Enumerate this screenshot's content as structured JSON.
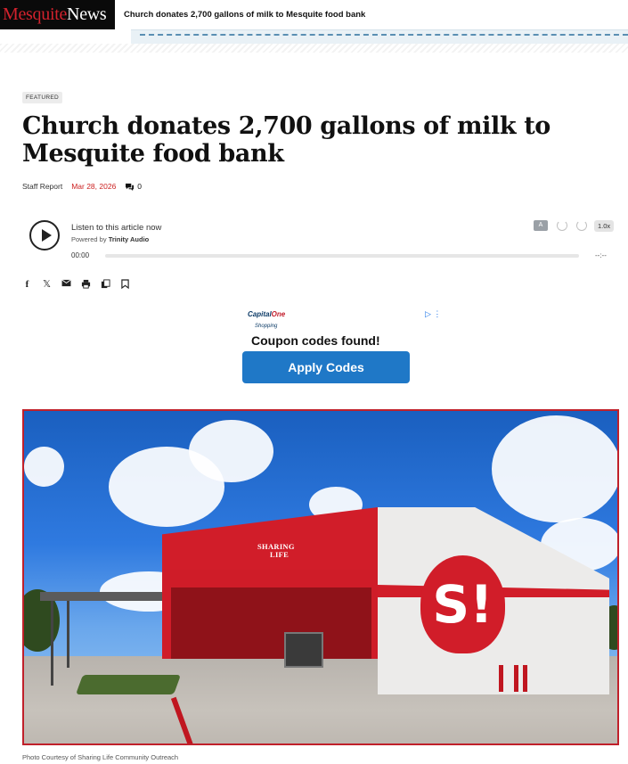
{
  "header": {
    "logo_part1": "Mesquite",
    "logo_part2": "News",
    "headline": "Church donates 2,700 gallons of milk to Mesquite food bank"
  },
  "article": {
    "category": "FEATURED",
    "title": "Church donates 2,700 gallons of milk to Mesquite food bank",
    "author": "Staff Report",
    "date": "Mar 28, 2026",
    "comment_count": "0",
    "caption": "Photo Courtesy of Sharing Life Community Outreach"
  },
  "audio": {
    "listen_label": "Listen to this article now",
    "powered_prefix": "Powered by",
    "powered_brand": "Trinity Audio",
    "time_current": "00:00",
    "time_total": "--:--",
    "speed": "1.0x",
    "progress": 0
  },
  "share": {
    "icons": [
      "facebook-icon",
      "x-icon",
      "email-icon",
      "print-icon",
      "copy-icon",
      "bookmark-icon"
    ]
  },
  "ad": {
    "brand": "Capital",
    "brand_one": "One",
    "brand_sub": "Shopping",
    "headline": "Coupon codes found!",
    "button_label": "Apply Codes"
  },
  "hero": {
    "sign_line1": "SHARING",
    "sign_line2": "LIFE"
  },
  "colors": {
    "brand_red": "#d2222d",
    "ad_button": "#1f78c7",
    "date_red": "#cc2222"
  }
}
